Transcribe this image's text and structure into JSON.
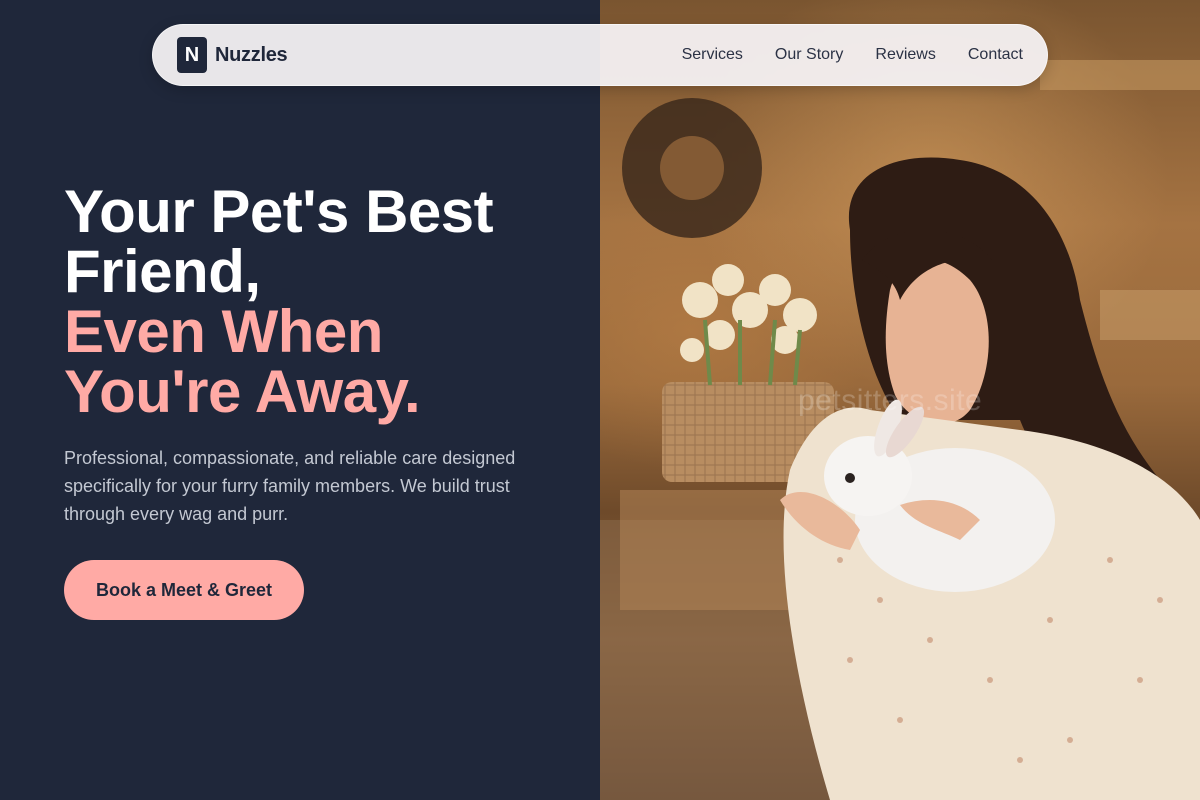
{
  "brand": {
    "mark": "N",
    "name": "Nuzzles"
  },
  "nav": {
    "items": [
      {
        "label": "Services"
      },
      {
        "label": "Our Story"
      },
      {
        "label": "Reviews"
      },
      {
        "label": "Contact"
      }
    ]
  },
  "hero": {
    "headline_lines": [
      {
        "text": "Your Pet's Best",
        "color": "#ffffff"
      },
      {
        "text": "Friend,",
        "color": "#ffffff"
      },
      {
        "text": "Even When",
        "color": "#ffaaa5"
      },
      {
        "text": "You're Away.",
        "color": "#ffaaa5"
      }
    ],
    "description": "Professional, compassionate, and reliable care designed specifically for your furry family members. We build trust through every wag and purr.",
    "cta_label": "Book a Meet & Greet",
    "image_watermark": "petsitters.site"
  },
  "colors": {
    "background_dark": "#1f273a",
    "accent_pink": "#ffaaa5",
    "text_muted": "#c3c8d2"
  }
}
